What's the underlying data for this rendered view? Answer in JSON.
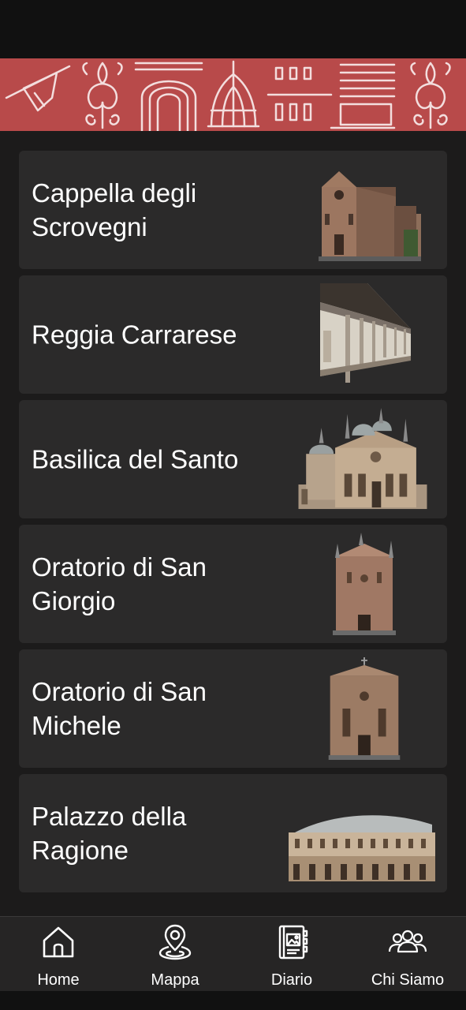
{
  "app": {
    "accent": "#b84a4a",
    "background": "#1c1b1b",
    "card_bg": "#2b2a2a"
  },
  "banner": {
    "motifs": [
      "banner-flag-icon",
      "fleur-de-lis-icon",
      "arch-gate-icon",
      "dome-icon",
      "facade-windows-icon",
      "fleur-de-lis-icon"
    ]
  },
  "monuments": [
    {
      "title": "Cappella degli Scrovegni",
      "image": "chapel-building-icon"
    },
    {
      "title": "Reggia Carrarese",
      "image": "loggia-building-icon"
    },
    {
      "title": "Basilica del Santo",
      "image": "basilica-domes-icon"
    },
    {
      "title": "Oratorio di San Giorgio",
      "image": "oratory-building-icon"
    },
    {
      "title": "Oratorio di San Michele",
      "image": "oratory-building-icon"
    },
    {
      "title": "Palazzo della Ragione",
      "image": "palace-hall-icon"
    }
  ],
  "nav": {
    "items": [
      {
        "label": "Home",
        "icon": "home-icon"
      },
      {
        "label": "Mappa",
        "icon": "map-pin-icon"
      },
      {
        "label": "Diario",
        "icon": "diary-icon"
      },
      {
        "label": "Chi Siamo",
        "icon": "people-icon"
      }
    ]
  }
}
